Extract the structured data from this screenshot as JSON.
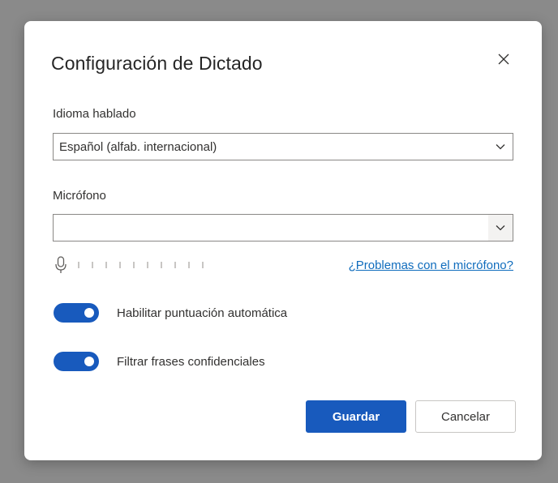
{
  "dialog": {
    "title": "Configuración de Dictado",
    "close_icon": "close-icon"
  },
  "language": {
    "label": "Idioma hablado",
    "selected": "Español (alfab. internacional)",
    "chevron_icon": "chevron-down-icon"
  },
  "microphone": {
    "label": "Micrófono",
    "selected": "",
    "chevron_icon": "chevron-down-icon",
    "mic_icon": "microphone-icon",
    "level": 0,
    "problems_link": "¿Problemas con el micrófono?"
  },
  "toggles": [
    {
      "label": "Habilitar puntuación automática",
      "on": true
    },
    {
      "label": "Filtrar frases confidenciales",
      "on": true
    }
  ],
  "buttons": {
    "save": "Guardar",
    "cancel": "Cancelar"
  },
  "colors": {
    "accent": "#185abd",
    "link": "#0f6cbd",
    "overlay": "#8a8a8a"
  }
}
